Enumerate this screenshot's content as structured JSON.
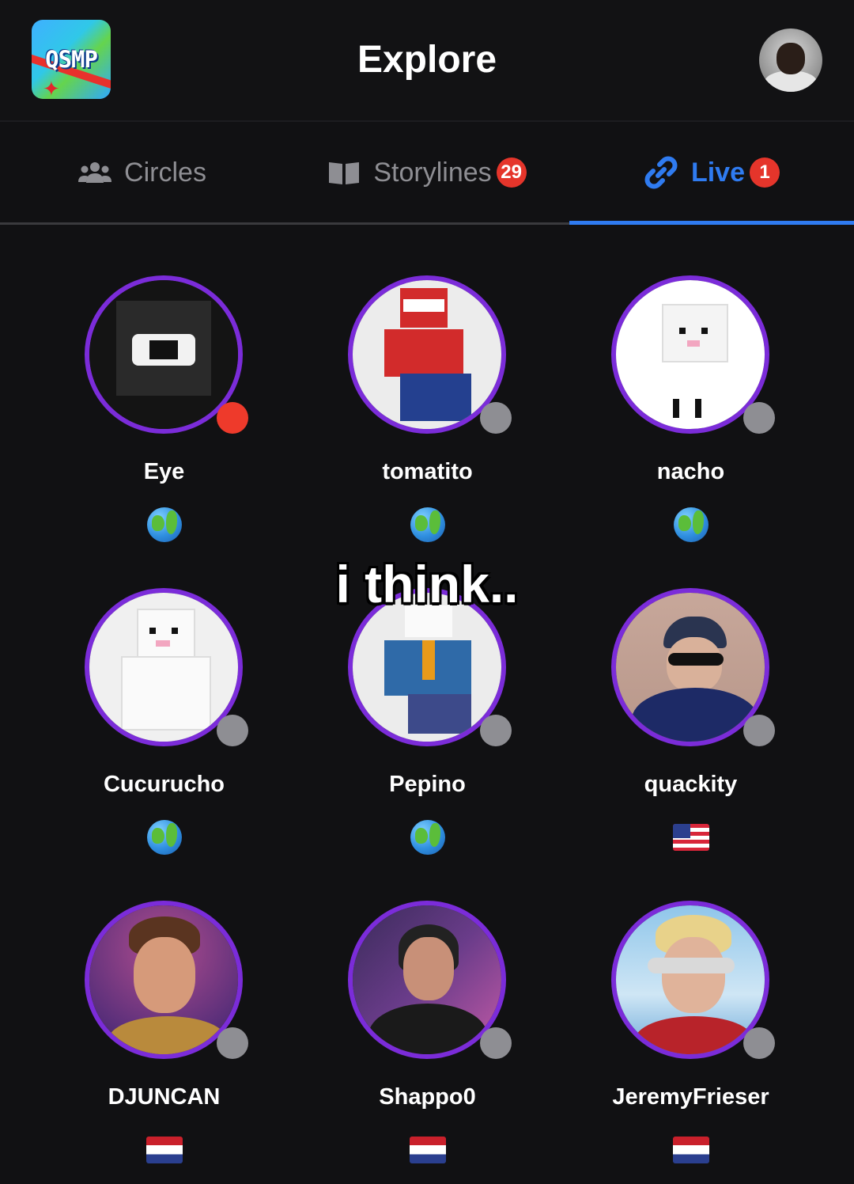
{
  "header": {
    "app_logo_text": "QSMP",
    "title": "Explore"
  },
  "tabs": [
    {
      "label": "Circles",
      "icon": "users-icon",
      "badge": null,
      "active": false
    },
    {
      "label": "Storylines",
      "icon": "book-icon",
      "badge": "29",
      "active": false
    },
    {
      "label": "Live",
      "icon": "link-icon",
      "badge": "1",
      "active": true
    }
  ],
  "creators": [
    {
      "name": "Eye",
      "status": "live",
      "flag": "globe"
    },
    {
      "name": "tomatito",
      "status": "offline",
      "flag": "globe"
    },
    {
      "name": "nacho",
      "status": "offline",
      "flag": "globe"
    },
    {
      "name": "Cucurucho",
      "status": "offline",
      "flag": "globe"
    },
    {
      "name": "Pepino",
      "status": "offline",
      "flag": "globe"
    },
    {
      "name": "quackity",
      "status": "offline",
      "flag": "us"
    },
    {
      "name": "DJUNCAN",
      "status": "offline",
      "flag": "nl"
    },
    {
      "name": "Shappo0",
      "status": "offline",
      "flag": "nl"
    },
    {
      "name": "JeremyFrieser",
      "status": "offline",
      "flag": "nl"
    }
  ],
  "caption": "i think..",
  "colors": {
    "background": "#111113",
    "accent": "#2f7bf0",
    "ring": "#7b2cd9",
    "badge": "#e5352b",
    "live_dot": "#ee3a2b",
    "offline_dot": "#8e8e93"
  }
}
